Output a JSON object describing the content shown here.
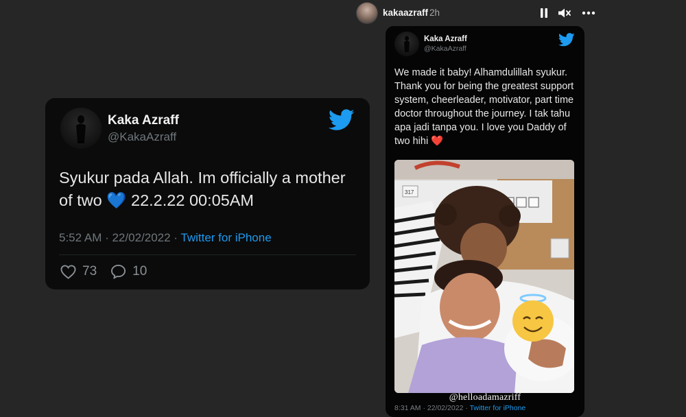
{
  "left_tweet": {
    "name": "Kaka Azraff",
    "handle": "@KakaAzraff",
    "text": "Syukur pada Allah. Im officially a mother of two 💙 22.2.22 00:05AM",
    "time": "5:52 AM · 22/02/2022 · ",
    "source": "Twitter for iPhone",
    "likes": "73",
    "replies": "10"
  },
  "story": {
    "username": "kakaazraff",
    "time": "2h"
  },
  "right_tweet": {
    "name": "Kaka Azraff",
    "handle": "@KakaAzraff",
    "text": "We made it baby! Alhamdulillah syukur. Thank you for being the greatest support system, cheerleader, motivator, part time doctor throughout the journey. I tak tahu apa jadi tanpa you. I love you Daddy of two hihi ❤️",
    "photo_tag": "@helloadamazriff",
    "room_label": "317",
    "time": "8:31 AM · 22/02/2022 · ",
    "source": "Twitter for iPhone"
  },
  "colors": {
    "background": "#262626",
    "card": "#0b0b0b",
    "twitter_blue": "#1d9bf0"
  },
  "icons": [
    "twitter-bird-icon",
    "heart-icon",
    "reply-icon",
    "pause-icon",
    "mute-icon",
    "more-icon"
  ]
}
